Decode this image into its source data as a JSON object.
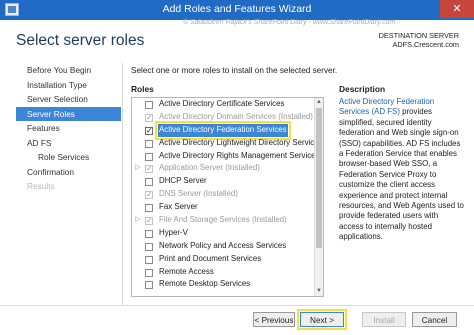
{
  "window": {
    "title": "Add Roles and Features Wizard",
    "close_glyph": "✕",
    "watermark": "© Salaudeen Rajack's SharePoint Diary - www.SharePointDiary.com"
  },
  "header": {
    "page_title": "Select server roles",
    "destination_label": "DESTINATION SERVER",
    "destination_value": "ADFS.Crescent.com"
  },
  "nav": {
    "items": [
      {
        "label": "Before You Begin",
        "state": "normal"
      },
      {
        "label": "Installation Type",
        "state": "normal"
      },
      {
        "label": "Server Selection",
        "state": "normal"
      },
      {
        "label": "Server Roles",
        "state": "active"
      },
      {
        "label": "Features",
        "state": "normal"
      },
      {
        "label": "AD FS",
        "state": "normal"
      },
      {
        "label": "Role Services",
        "state": "sub"
      },
      {
        "label": "Confirmation",
        "state": "normal"
      },
      {
        "label": "Results",
        "state": "disabled"
      }
    ]
  },
  "main": {
    "intro": "Select one or more roles to install on the selected server.",
    "roles_header": "Roles",
    "description_header": "Description",
    "roles": [
      {
        "label": "Active Directory Certificate Services",
        "checked": false,
        "dim": false,
        "expandable": false,
        "selected": false
      },
      {
        "label": "Active Directory Domain Services (Installed)",
        "checked": true,
        "dim": true,
        "expandable": false,
        "selected": false
      },
      {
        "label": "Active Directory Federation Services",
        "checked": true,
        "dim": false,
        "expandable": false,
        "selected": true
      },
      {
        "label": "Active Directory Lightweight Directory Services",
        "checked": false,
        "dim": false,
        "expandable": false,
        "selected": false
      },
      {
        "label": "Active Directory Rights Management Services",
        "checked": false,
        "dim": false,
        "expandable": false,
        "selected": false
      },
      {
        "label": "Application Server (Installed)",
        "checked": true,
        "dim": true,
        "expandable": true,
        "selected": false
      },
      {
        "label": "DHCP Server",
        "checked": false,
        "dim": false,
        "expandable": false,
        "selected": false
      },
      {
        "label": "DNS Server (Installed)",
        "checked": true,
        "dim": true,
        "expandable": false,
        "selected": false
      },
      {
        "label": "Fax Server",
        "checked": false,
        "dim": false,
        "expandable": false,
        "selected": false
      },
      {
        "label": "File And Storage Services (Installed)",
        "checked": true,
        "dim": true,
        "expandable": true,
        "selected": false
      },
      {
        "label": "Hyper-V",
        "checked": false,
        "dim": false,
        "expandable": false,
        "selected": false
      },
      {
        "label": "Network Policy and Access Services",
        "checked": false,
        "dim": false,
        "expandable": false,
        "selected": false
      },
      {
        "label": "Print and Document Services",
        "checked": false,
        "dim": false,
        "expandable": false,
        "selected": false
      },
      {
        "label": "Remote Access",
        "checked": false,
        "dim": false,
        "expandable": false,
        "selected": false
      },
      {
        "label": "Remote Desktop Services",
        "checked": false,
        "dim": false,
        "expandable": false,
        "selected": false
      }
    ],
    "description_link": "Active Directory Federation Services (AD FS)",
    "description_text": " provides simplified, secured identity federation and Web single sign-on (SSO) capabilities. AD FS includes a Federation Service that enables browser-based Web SSO, a Federation Service Proxy to customize the client access experience and protect internal resources, and Web Agents used to provide federated users with access to internally hosted applications."
  },
  "footer": {
    "previous_label": "< Previous",
    "next_label": "Next >",
    "install_label": "Install",
    "cancel_label": "Cancel"
  },
  "colors": {
    "titlebar": "#1f6bc6",
    "selection": "#3b86d6",
    "highlight_outline": "#f2e23a",
    "close_button": "#c7463c"
  }
}
